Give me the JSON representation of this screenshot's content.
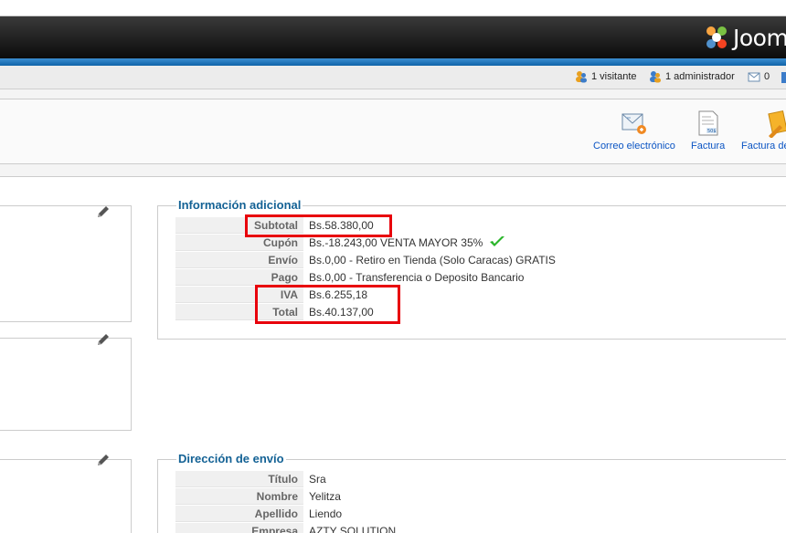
{
  "brand": {
    "logo_text": "Joomla"
  },
  "status": {
    "visitors": "1 visitante",
    "admins": "1 administrador",
    "messages": "0"
  },
  "toolbar": {
    "email_label": "Correo electrónico",
    "invoice_label": "Factura",
    "invoice2_label": "Factura de"
  },
  "additional_info": {
    "legend": "Información adicional",
    "rows": [
      {
        "label": "Subtotal",
        "value": "Bs.58.380,00"
      },
      {
        "label": "Cupón",
        "value": "Bs.-18.243,00 VENTA MAYOR 35%"
      },
      {
        "label": "Envío",
        "value": "Bs.0,00 - Retiro en Tienda (Solo Caracas) GRATIS"
      },
      {
        "label": "Pago",
        "value": "Bs.0,00 - Transferencia o Deposito Bancario"
      },
      {
        "label": "IVA",
        "value": "Bs.6.255,18"
      },
      {
        "label": "Total",
        "value": "Bs.40.137,00"
      }
    ]
  },
  "shipping": {
    "legend": "Dirección de envío",
    "rows": [
      {
        "label": "Título",
        "value": "Sra"
      },
      {
        "label": "Nombre",
        "value": "Yelitza"
      },
      {
        "label": "Apellido",
        "value": "Liendo"
      },
      {
        "label": "Empresa",
        "value": "AZTY SOLUTION"
      }
    ]
  },
  "colors": {
    "accent_blue": "#146295",
    "highlight_red": "#e8000b",
    "link_blue": "#0b55c4"
  }
}
